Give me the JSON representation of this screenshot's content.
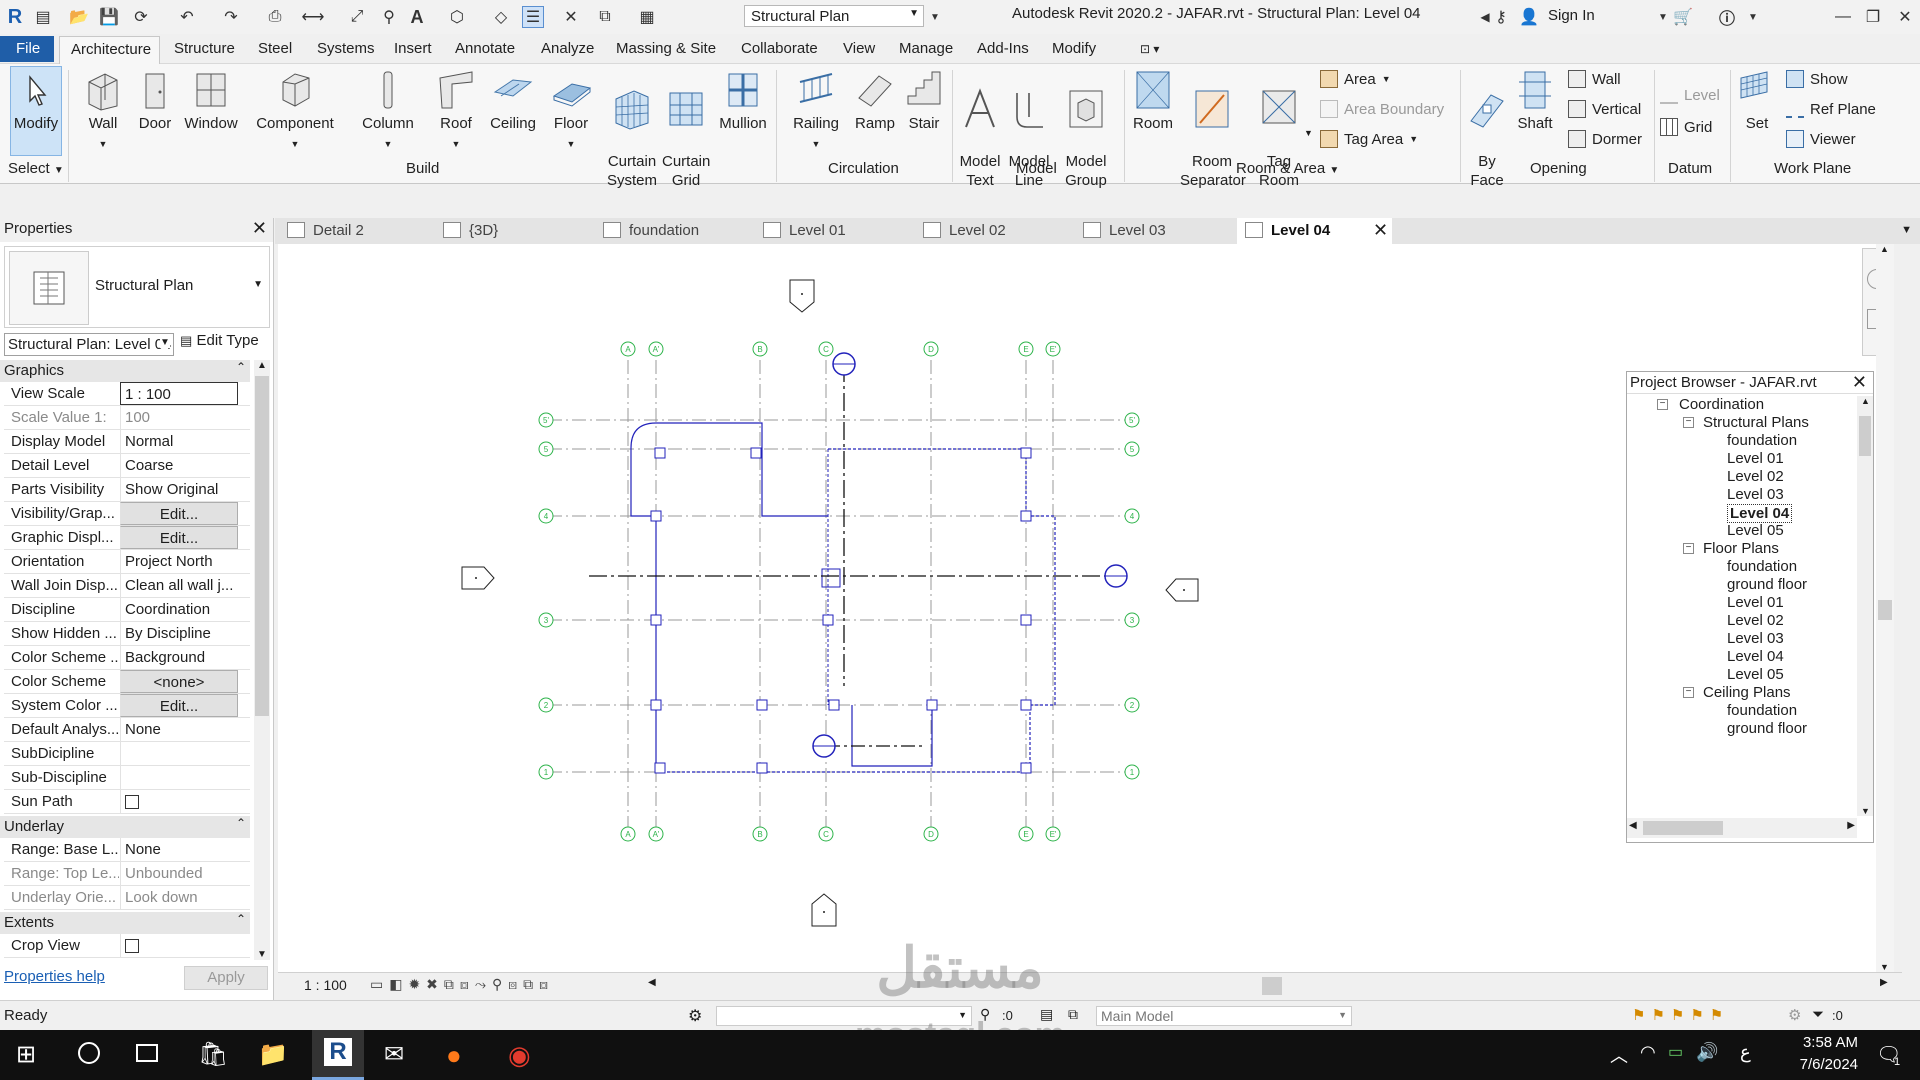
{
  "window": {
    "title": "Autodesk Revit 2020.2 - JAFAR.rvt - Structural Plan: Level 04",
    "view_selector": "Structural Plan",
    "sign_in": "Sign In"
  },
  "tabs": [
    "File",
    "Architecture",
    "Structure",
    "Steel",
    "Systems",
    "Insert",
    "Annotate",
    "Analyze",
    "Massing & Site",
    "Collaborate",
    "View",
    "Manage",
    "Add-Ins",
    "Modify"
  ],
  "ribbon": {
    "select": "Select",
    "modify": "Modify",
    "build": [
      "Wall",
      "Door",
      "Window",
      "Component",
      "Column",
      "Roof",
      "Ceiling",
      "Floor",
      "Curtain\nSystem",
      "Curtain\nGrid",
      "Mullion"
    ],
    "circulation": [
      "Railing",
      "Ramp",
      "Stair"
    ],
    "model": [
      "Model\nText",
      "Model\nLine",
      "Model\nGroup"
    ],
    "room": [
      "Room",
      "Room\nSeparator",
      "Tag\nRoom"
    ],
    "room_small": [
      "Area",
      "Area  Boundary",
      "Tag  Area"
    ],
    "opening_big": [
      "By\nFace",
      "Shaft"
    ],
    "opening_small": [
      "Wall",
      "Vertical",
      "Dormer"
    ],
    "datum": [
      "Level",
      "Grid"
    ],
    "set": "Set",
    "workplane": [
      "Show",
      "Ref  Plane",
      "Viewer"
    ],
    "groups": [
      "Build",
      "Circulation",
      "Model",
      "Room & Area",
      "Opening",
      "Datum",
      "Work Plane"
    ]
  },
  "properties": {
    "title": "Properties",
    "type_name": "Structural Plan",
    "instance_selector": "Structural Plan: Level 04",
    "edit_type": "Edit Type",
    "sections": {
      "graphics": "Graphics",
      "underlay": "Underlay",
      "extents": "Extents"
    },
    "rows": [
      {
        "k": "View Scale",
        "v": "1 : 100"
      },
      {
        "k": "Scale Value    1:",
        "v": "100"
      },
      {
        "k": "Display Model",
        "v": "Normal"
      },
      {
        "k": "Detail Level",
        "v": "Coarse"
      },
      {
        "k": "Parts Visibility",
        "v": "Show Original"
      },
      {
        "k": "Visibility/Grap...",
        "v": "Edit..."
      },
      {
        "k": "Graphic Displ...",
        "v": "Edit..."
      },
      {
        "k": "Orientation",
        "v": "Project North"
      },
      {
        "k": "Wall Join Disp...",
        "v": "Clean all wall j..."
      },
      {
        "k": "Discipline",
        "v": "Coordination"
      },
      {
        "k": "Show Hidden ...",
        "v": "By Discipline"
      },
      {
        "k": "Color Scheme ...",
        "v": "Background"
      },
      {
        "k": "Color Scheme",
        "v": "<none>"
      },
      {
        "k": "System Color ...",
        "v": "Edit..."
      },
      {
        "k": "Default Analys...",
        "v": "None"
      },
      {
        "k": "SubDicipline",
        "v": ""
      },
      {
        "k": "Sub-Discipline",
        "v": ""
      },
      {
        "k": "Sun Path",
        "v": ""
      }
    ],
    "underlay_rows": [
      {
        "k": "Range: Base L...",
        "v": "None"
      },
      {
        "k": "Range: Top Le...",
        "v": "Unbounded"
      },
      {
        "k": "Underlay Orie...",
        "v": "Look down"
      }
    ],
    "extents_rows": [
      {
        "k": "Crop View",
        "v": ""
      }
    ],
    "help": "Properties help",
    "apply": "Apply"
  },
  "view_tabs": [
    "Detail 2",
    "{3D}",
    "foundation",
    "Level 01",
    "Level 02",
    "Level 03",
    "Level 04"
  ],
  "project_browser": {
    "title": "Project Browser - JAFAR.rvt",
    "items": [
      {
        "t": "Coordination",
        "lvl": 0,
        "exp": true
      },
      {
        "t": "Structural Plans",
        "lvl": 1,
        "exp": true
      },
      {
        "t": "foundation",
        "lvl": 2
      },
      {
        "t": "Level 01",
        "lvl": 2
      },
      {
        "t": "Level 02",
        "lvl": 2
      },
      {
        "t": "Level 03",
        "lvl": 2
      },
      {
        "t": "Level 04",
        "lvl": 2,
        "bold": true
      },
      {
        "t": "Level 05",
        "lvl": 2
      },
      {
        "t": "Floor Plans",
        "lvl": 1,
        "exp": true
      },
      {
        "t": "foundation",
        "lvl": 2
      },
      {
        "t": "ground floor",
        "lvl": 2
      },
      {
        "t": "Level 01",
        "lvl": 2
      },
      {
        "t": "Level 02",
        "lvl": 2
      },
      {
        "t": "Level 03",
        "lvl": 2
      },
      {
        "t": "Level 04",
        "lvl": 2
      },
      {
        "t": "Level 05",
        "lvl": 2
      },
      {
        "t": "Ceiling Plans",
        "lvl": 1,
        "exp": true
      },
      {
        "t": "foundation",
        "lvl": 2
      },
      {
        "t": "ground floor",
        "lvl": 2
      }
    ]
  },
  "drawing": {
    "grid_top": [
      "A",
      "A'",
      "B",
      "C",
      "D",
      "E",
      "E'"
    ],
    "grid_side": [
      "5'",
      "5",
      "4",
      "3",
      "2",
      "1"
    ],
    "accent": "#2222bb",
    "grid_bubble_color": "#2db34a"
  },
  "view_control": {
    "scale": "1 : 100"
  },
  "status": {
    "text": "Ready",
    "model": "Main Model",
    "sel_count": ":0",
    "filter_count": ":0"
  },
  "taskbar": {
    "time": "3:58 AM",
    "date": "7/6/2024",
    "lang": "ع",
    "notif": "1"
  },
  "watermark": {
    "ar": "مستقل",
    "en": "mostaql.com"
  }
}
